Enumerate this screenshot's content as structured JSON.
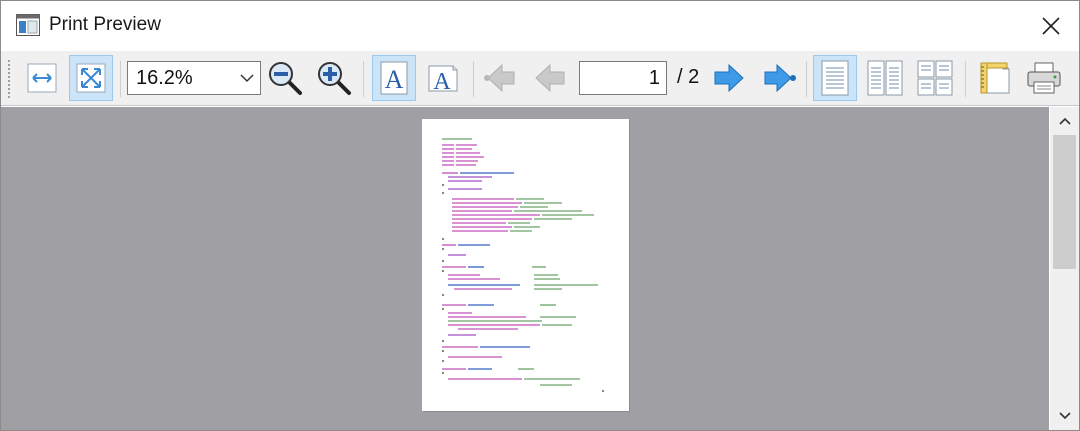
{
  "window": {
    "title": "Print Preview"
  },
  "toolbar": {
    "zoom_value": "16.2%",
    "current_page": "1",
    "page_total": "/ 2"
  }
}
